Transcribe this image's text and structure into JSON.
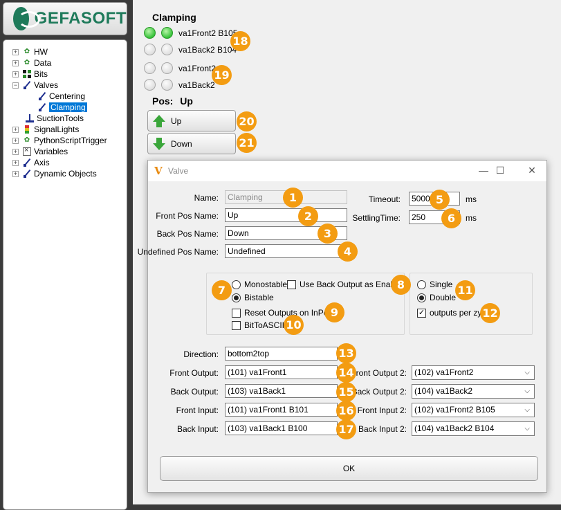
{
  "logo": {
    "text": "GEFASOFT"
  },
  "tree": {
    "items": [
      {
        "label": "HW",
        "icon": "gear-icon",
        "expander": "+"
      },
      {
        "label": "Data",
        "icon": "gear-icon",
        "expander": "+"
      },
      {
        "label": "Bits",
        "icon": "grid-icon",
        "expander": "+"
      },
      {
        "label": "Valves",
        "icon": "valve-icon",
        "expander": "−"
      },
      {
        "label": "Centering",
        "icon": "valve-icon",
        "expander": ""
      },
      {
        "label": "Clamping",
        "icon": "valve-icon",
        "expander": "",
        "selected": true
      },
      {
        "label": "SuctionTools",
        "icon": "suction-icon",
        "expander": ""
      },
      {
        "label": "SignalLights",
        "icon": "signal-light-icon",
        "expander": "+"
      },
      {
        "label": "PythonScriptTrigger",
        "icon": "gear-icon",
        "expander": "+"
      },
      {
        "label": "Variables",
        "icon": "variables-icon",
        "expander": "+"
      },
      {
        "label": "Axis",
        "icon": "valve-icon",
        "expander": "+"
      },
      {
        "label": "Dynamic Objects",
        "icon": "valve-icon",
        "expander": "+"
      }
    ]
  },
  "panel": {
    "title": "Clamping",
    "leds": [
      {
        "label": "va1Front2 B105",
        "on": true
      },
      {
        "label": "va1Back2 B104",
        "on": false
      },
      {
        "label": "va1Front2",
        "on": false
      },
      {
        "label": "va1Back2",
        "on": false
      }
    ],
    "pos_label": "Pos:",
    "pos_value": "Up",
    "up_button": "Up",
    "down_button": "Down"
  },
  "dialog": {
    "title": "Valve",
    "controls": {
      "minimize": "—",
      "maximize": "☐",
      "close": "✕"
    },
    "name_label": "Name:",
    "name_value": "Clamping",
    "front_pos_label": "Front Pos Name:",
    "front_pos_value": "Up",
    "back_pos_label": "Back Pos Name:",
    "back_pos_value": "Down",
    "undefined_pos_label": "Undefined Pos Name:",
    "undefined_pos_value": "Undefined",
    "timeout_label": "Timeout:",
    "timeout_value": "5000",
    "timeout_unit": "ms",
    "settling_label": "SettlingTime:",
    "settling_value": "250",
    "settling_unit": "ms",
    "monostable": "Monostable",
    "bistable": "Bistable",
    "use_back_output": "Use Back Output as Enable",
    "reset_outputs": "Reset Outputs on InPos",
    "bit_to_ascii": "BitToASCII",
    "single": "Single",
    "double": "Double",
    "outputs_per_zyl": "outputs per zyl.",
    "direction_label": "Direction:",
    "direction_value": "bottom2top",
    "front_output_label": "Front Output:",
    "front_output_value": "(101) va1Front1",
    "back_output_label": "Back Output:",
    "back_output_value": "(103) va1Back1",
    "front_input_label": "Front Input:",
    "front_input_value": "(101) va1Front1 B101",
    "back_input_label": "Back Input:",
    "back_input_value": "(103) va1Back1 B100",
    "front_output2_label": "Front Output 2:",
    "front_output2_value": "(102) va1Front2",
    "back_output2_label": "Back Output 2:",
    "back_output2_value": "(104) va1Back2",
    "front_input2_label": "Front Input 2:",
    "front_input2_value": "(102) va1Front2 B105",
    "back_input2_label": "Back Input 2:",
    "back_input2_value": "(104) va1Back2 B104",
    "ok": "OK"
  },
  "markers": [
    "1",
    "2",
    "3",
    "4",
    "5",
    "6",
    "7",
    "8",
    "9",
    "10",
    "11",
    "12",
    "13",
    "14",
    "15",
    "16",
    "17",
    "18",
    "19",
    "20",
    "21"
  ],
  "colors": {
    "marker": "#f39c12",
    "selection": "#0078d7",
    "led_on": "#37c23a",
    "brand": "#1e7a5a"
  }
}
